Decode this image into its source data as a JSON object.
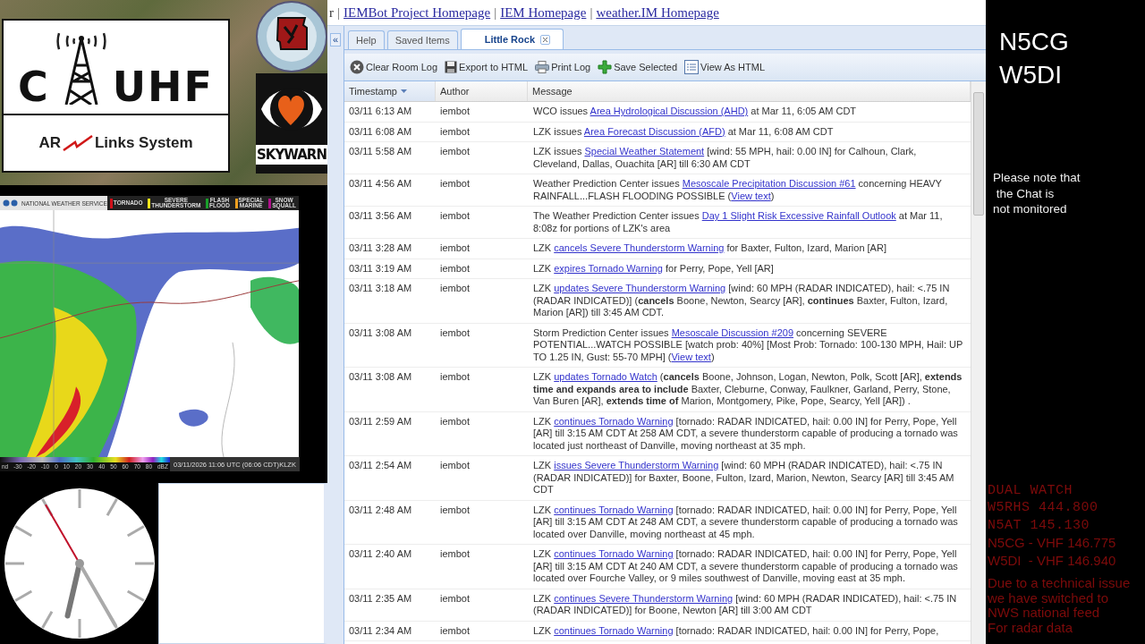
{
  "logo": {
    "name_start": "C",
    "name_end": "UHF",
    "tagline_start": "AR",
    "tagline_end": "Links System"
  },
  "skywarn": {
    "label": "SKYWARN"
  },
  "radar": {
    "agency": "NATIONAL WEATHER SERVICE",
    "legend": [
      {
        "label": "TORNADO",
        "color": "#d0101a"
      },
      {
        "label": "SEVERE THUNDERSTORM",
        "color": "#f2e51a"
      },
      {
        "label": "FLASH FLOOD",
        "color": "#1aa02a"
      },
      {
        "label": "SPECIAL MARINE",
        "color": "#f0a020"
      },
      {
        "label": "SNOW SQUALL",
        "color": "#b0108a"
      }
    ],
    "scale_labels": [
      "nd",
      "-30",
      "-20",
      "-10",
      "0",
      "10",
      "20",
      "30",
      "40",
      "50",
      "60",
      "70",
      "80",
      "dBZ"
    ],
    "timestamp": "03/11/2026 11:06 UTC (06:06 CDT)",
    "station": "KLZK"
  },
  "links": {
    "cut_text": "r",
    "items": [
      "IEMBot Project Homepage",
      "IEM Homepage",
      "weather.IM Homepage"
    ],
    "separator": "|"
  },
  "collapse": {
    "label": "«"
  },
  "tabs": [
    {
      "label": "Help",
      "selected": false,
      "closable": false
    },
    {
      "label": "Saved Items",
      "selected": false,
      "closable": false
    },
    {
      "label": "Little Rock",
      "selected": true,
      "closable": true
    }
  ],
  "toolbar": [
    {
      "label": "Clear Room Log",
      "kind": "clear"
    },
    {
      "label": "Export to HTML",
      "kind": "export"
    },
    {
      "label": "Print Log",
      "kind": "print"
    },
    {
      "label": "Save Selected",
      "kind": "save"
    },
    {
      "label": "View As HTML",
      "kind": "view"
    }
  ],
  "table": {
    "columns": [
      {
        "label": "Timestamp",
        "sorted": true
      },
      {
        "label": "Author",
        "sorted": false
      },
      {
        "label": "Message",
        "sorted": false
      }
    ],
    "rows": [
      {
        "timestamp": "03/11 6:13 AM",
        "author": "iembot",
        "message": [
          {
            "kind": "text",
            "text": "WCO issues "
          },
          {
            "kind": "link",
            "text": "Area Hydrological Discussion (AHD)"
          },
          {
            "kind": "text",
            "text": " at Mar 11, 6:05 AM CDT"
          }
        ]
      },
      {
        "timestamp": "03/11 6:08 AM",
        "author": "iembot",
        "message": [
          {
            "kind": "text",
            "text": "LZK issues "
          },
          {
            "kind": "link",
            "text": "Area Forecast Discussion (AFD)"
          },
          {
            "kind": "text",
            "text": " at Mar 11, 6:08 AM CDT"
          }
        ]
      },
      {
        "timestamp": "03/11 5:58 AM",
        "author": "iembot",
        "message": [
          {
            "kind": "text",
            "text": "LZK issues "
          },
          {
            "kind": "link",
            "text": "Special Weather Statement"
          },
          {
            "kind": "text",
            "text": " [wind: 55 MPH, hail: 0.00 IN] for Calhoun, Clark, Cleveland, Dallas, Ouachita [AR] till 6:30 AM CDT"
          }
        ]
      },
      {
        "timestamp": "03/11 4:56 AM",
        "author": "iembot",
        "message": [
          {
            "kind": "text",
            "text": "Weather Prediction Center issues "
          },
          {
            "kind": "link",
            "text": "Mesoscale Precipitation Discussion #61"
          },
          {
            "kind": "text",
            "text": " concerning HEAVY RAINFALL...FLASH FLOODING POSSIBLE ("
          },
          {
            "kind": "link",
            "text": "View text"
          },
          {
            "kind": "text",
            "text": ")"
          }
        ]
      },
      {
        "timestamp": "03/11 3:56 AM",
        "author": "iembot",
        "message": [
          {
            "kind": "text",
            "text": "The Weather Prediction Center issues "
          },
          {
            "kind": "link",
            "text": "Day 1 Slight Risk Excessive Rainfall Outlook"
          },
          {
            "kind": "text",
            "text": " at Mar 11, 8:08z for portions of LZK's area"
          }
        ]
      },
      {
        "timestamp": "03/11 3:28 AM",
        "author": "iembot",
        "message": [
          {
            "kind": "text",
            "text": "LZK "
          },
          {
            "kind": "link",
            "text": "cancels Severe Thunderstorm Warning"
          },
          {
            "kind": "text",
            "text": " for Baxter, Fulton, Izard, Marion [AR]"
          }
        ]
      },
      {
        "timestamp": "03/11 3:19 AM",
        "author": "iembot",
        "message": [
          {
            "kind": "text",
            "text": "LZK "
          },
          {
            "kind": "link",
            "text": "expires Tornado Warning"
          },
          {
            "kind": "text",
            "text": " for Perry, Pope, Yell [AR]"
          }
        ]
      },
      {
        "timestamp": "03/11 3:18 AM",
        "author": "iembot",
        "message": [
          {
            "kind": "text",
            "text": "LZK "
          },
          {
            "kind": "link",
            "text": "updates Severe Thunderstorm Warning"
          },
          {
            "kind": "text",
            "text": " [wind: 60 MPH (RADAR INDICATED), hail: <.75 IN (RADAR INDICATED)] ("
          },
          {
            "kind": "bold",
            "text": "cancels"
          },
          {
            "kind": "text",
            "text": " Boone, Newton, Searcy [AR], "
          },
          {
            "kind": "bold",
            "text": "continues"
          },
          {
            "kind": "text",
            "text": " Baxter, Fulton, Izard, Marion [AR]) till 3:45 AM CDT."
          }
        ]
      },
      {
        "timestamp": "03/11 3:08 AM",
        "author": "iembot",
        "message": [
          {
            "kind": "text",
            "text": "Storm Prediction Center issues "
          },
          {
            "kind": "link",
            "text": "Mesoscale Discussion #209"
          },
          {
            "kind": "text",
            "text": " concerning SEVERE POTENTIAL...WATCH POSSIBLE [watch prob: 40%] [Most Prob: Tornado: 100-130 MPH, Hail: UP TO 1.25 IN, Gust: 55-70 MPH] ("
          },
          {
            "kind": "link",
            "text": "View text"
          },
          {
            "kind": "text",
            "text": ")"
          }
        ]
      },
      {
        "timestamp": "03/11 3:08 AM",
        "author": "iembot",
        "message": [
          {
            "kind": "text",
            "text": "LZK "
          },
          {
            "kind": "link",
            "text": "updates Tornado Watch"
          },
          {
            "kind": "text",
            "text": " ("
          },
          {
            "kind": "bold",
            "text": "cancels"
          },
          {
            "kind": "text",
            "text": " Boone, Johnson, Logan, Newton, Polk, Scott [AR], "
          },
          {
            "kind": "bold",
            "text": "extends time and expands area to include"
          },
          {
            "kind": "text",
            "text": " Baxter, Cleburne, Conway, Faulkner, Garland, Perry, Stone, Van Buren [AR], "
          },
          {
            "kind": "bold",
            "text": "extends time of"
          },
          {
            "kind": "text",
            "text": " Marion, Montgomery, Pike, Pope, Searcy, Yell [AR]) ."
          }
        ]
      },
      {
        "timestamp": "03/11 2:59 AM",
        "author": "iembot",
        "message": [
          {
            "kind": "text",
            "text": "LZK "
          },
          {
            "kind": "link",
            "text": "continues Tornado Warning"
          },
          {
            "kind": "text",
            "text": " [tornado: RADAR INDICATED, hail: 0.00 IN] for Perry, Pope, Yell [AR] till 3:15 AM CDT At 258 AM CDT, a severe thunderstorm capable of producing a tornado was located just northeast of Danville, moving northeast at 35 mph."
          }
        ]
      },
      {
        "timestamp": "03/11 2:54 AM",
        "author": "iembot",
        "message": [
          {
            "kind": "text",
            "text": "LZK "
          },
          {
            "kind": "link",
            "text": "issues Severe Thunderstorm Warning"
          },
          {
            "kind": "text",
            "text": " [wind: 60 MPH (RADAR INDICATED), hail: <.75 IN (RADAR INDICATED)] for Baxter, Boone, Fulton, Izard, Marion, Newton, Searcy [AR] till 3:45 AM CDT"
          }
        ]
      },
      {
        "timestamp": "03/11 2:48 AM",
        "author": "iembot",
        "message": [
          {
            "kind": "text",
            "text": "LZK "
          },
          {
            "kind": "link",
            "text": "continues Tornado Warning"
          },
          {
            "kind": "text",
            "text": " [tornado: RADAR INDICATED, hail: 0.00 IN] for Perry, Pope, Yell [AR] till 3:15 AM CDT At 248 AM CDT, a severe thunderstorm capable of producing a tornado was located over Danville, moving northeast at 45 mph."
          }
        ]
      },
      {
        "timestamp": "03/11 2:40 AM",
        "author": "iembot",
        "message": [
          {
            "kind": "text",
            "text": "LZK "
          },
          {
            "kind": "link",
            "text": "continues Tornado Warning"
          },
          {
            "kind": "text",
            "text": " [tornado: RADAR INDICATED, hail: 0.00 IN] for Perry, Pope, Yell [AR] till 3:15 AM CDT At 240 AM CDT, a severe thunderstorm capable of producing a tornado was located over Fourche Valley, or 9 miles southwest of Danville, moving east at 35 mph."
          }
        ]
      },
      {
        "timestamp": "03/11 2:35 AM",
        "author": "iembot",
        "message": [
          {
            "kind": "text",
            "text": "LZK "
          },
          {
            "kind": "link",
            "text": "continues Severe Thunderstorm Warning"
          },
          {
            "kind": "text",
            "text": " [wind: 60 MPH (RADAR INDICATED), hail: <.75 IN (RADAR INDICATED)] for Boone, Newton [AR] till 3:00 AM CDT"
          }
        ]
      },
      {
        "timestamp": "03/11 2:34 AM",
        "author": "iembot",
        "message": [
          {
            "kind": "text",
            "text": "LZK "
          },
          {
            "kind": "link",
            "text": "continues Tornado Warning"
          },
          {
            "kind": "text",
            "text": " [tornado: RADAR INDICATED, hail: 0.00 IN] for Perry, Pope,"
          }
        ]
      }
    ]
  },
  "side": {
    "callsigns": [
      "N5CG",
      "W5DI"
    ],
    "note": [
      "Please note that",
      " the Chat is",
      "not monitored"
    ],
    "watch_lines": [
      {
        "text": "DUAL WATCH",
        "kind": "mono"
      },
      {
        "text": "W5RHS 444.800",
        "kind": "mono"
      },
      {
        "text": "N5AT 145.130",
        "kind": "mono"
      },
      {
        "text": "N5CG - VHF 146.775",
        "kind": "sans"
      },
      {
        "text": "W5DI  - VHF 146.940",
        "kind": "sans"
      }
    ],
    "notice": [
      "Due to a technical issue",
      "we have switched to",
      "NWS national feed",
      "For radar data"
    ]
  }
}
